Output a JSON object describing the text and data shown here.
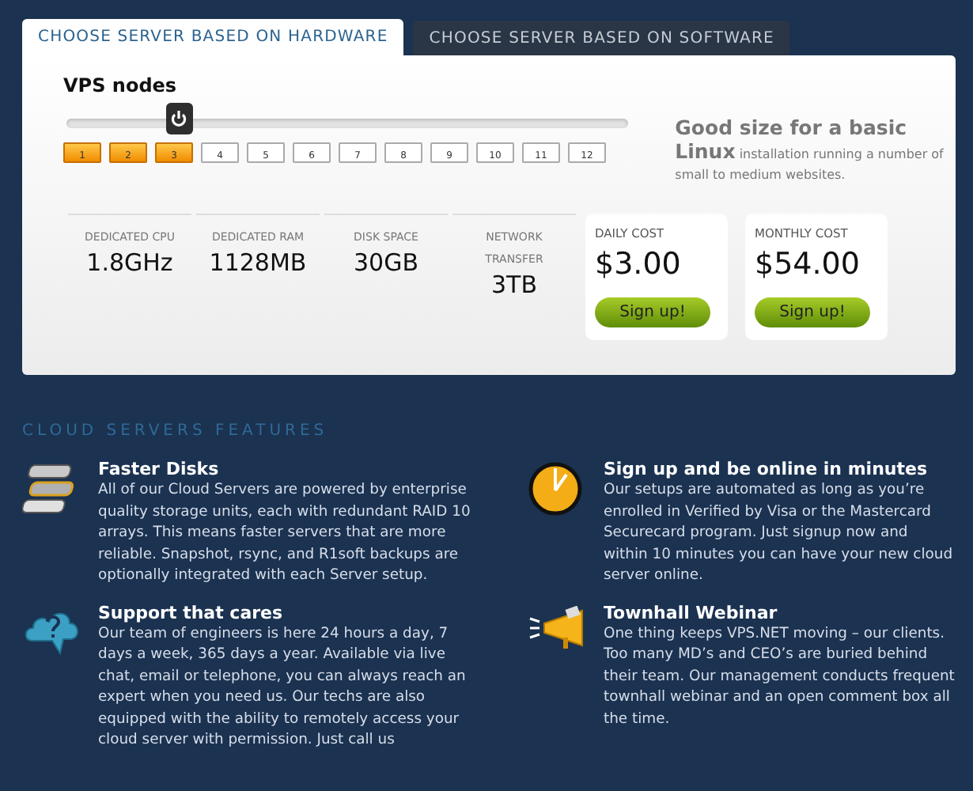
{
  "tabs": [
    {
      "label": "CHOOSE SERVER BASED ON HARDWARE",
      "selected": true
    },
    {
      "label": "CHOOSE SERVER BASED ON SOFTWARE",
      "selected": false
    }
  ],
  "configurator": {
    "title": "VPS nodes",
    "level": 0.2,
    "nodes": [
      {
        "label": "1",
        "selected": true
      },
      {
        "label": "2",
        "selected": true
      },
      {
        "label": "3",
        "selected": true
      },
      {
        "label": "4",
        "selected": false
      },
      {
        "label": "5",
        "selected": false
      },
      {
        "label": "6",
        "selected": false
      },
      {
        "label": "7",
        "selected": false
      },
      {
        "label": "8",
        "selected": false
      },
      {
        "label": "9",
        "selected": false
      },
      {
        "label": "10",
        "selected": false
      },
      {
        "label": "11",
        "selected": false
      },
      {
        "label": "12",
        "selected": false
      }
    ],
    "description": "**Good size for a basic Linux** installation running a number of small to medium websites.",
    "specs": [
      {
        "label": "DEDICATED CPU",
        "value": "1.8GHz"
      },
      {
        "label": "DEDICATED RAM",
        "value": "1128MB"
      },
      {
        "label": "DISK SPACE",
        "value": "30GB"
      },
      {
        "label": "NETWORK TRANSFER",
        "value": "3TB"
      }
    ],
    "costs": [
      {
        "label": "DAILY COST",
        "price": "$3.00",
        "button": "Sign up!"
      },
      {
        "label": "MONTHLY COST",
        "price": "$54.00",
        "button": "Sign up!"
      }
    ]
  },
  "features": {
    "title": "CLOUD SERVERS FEATURES",
    "items": [
      {
        "kind": "disks",
        "title": "Faster Disks",
        "text": "All of our Cloud Servers are powered by enterprise quality storage units, each with redundant RAID 10 arrays. This means faster servers that are more reliable. Snapshot, rsync, and R1soft backups are optionally integrated with each Server setup."
      },
      {
        "kind": "clock",
        "title": "Sign up and be online in minutes",
        "text": "Our setups are automated as long as you’re enrolled in Verified by Visa or the Mastercard Securecard program. Just signup now and within 10 minutes you can have your new cloud server online."
      },
      {
        "kind": "support",
        "title": "Support that cares",
        "text": "Our team of engineers is here 24 hours a day, 7 days a week, 365 days a year. Available via live chat, email or telephone, you can always reach an expert when you need us. Our techs are also equipped with the ability to remotely access your cloud server with permission. Just call us"
      },
      {
        "kind": "megaphone",
        "title": "Townhall Webinar",
        "text": "One thing keeps VPS.NET moving – our clients. Too many MD’s and CEO’s are buried behind their team. Our management conducts frequent townhall webinar and an open comment box all the time."
      }
    ]
  }
}
